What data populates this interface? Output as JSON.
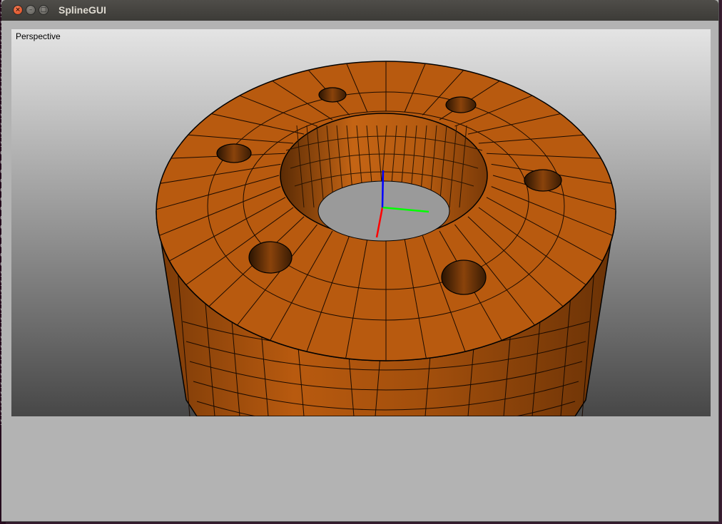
{
  "window": {
    "title": "SplineGUI",
    "buttons": {
      "close": "×",
      "minimize": "–",
      "maximize": "□"
    }
  },
  "background_terminal": {
    "lines": [
      "y",
      "y",
      "y",
      "y",
      "y",
      "y",
      "y",
      "y",
      "y",
      "y",
      "y",
      "y",
      "y",
      "y",
      "y",
      "y",
      "e",
      "e",
      "e",
      "e",
      "e",
      "e",
      "e",
      "e",
      "e",
      "e",
      "e",
      "e",
      "e",
      "y",
      "y",
      "y",
      "y",
      "y",
      "y",
      "y",
      "y",
      "y",
      "y",
      "y",
      "y",
      "y",
      "y",
      "y",
      "y",
      "y"
    ]
  },
  "viewport": {
    "label": "Perspective",
    "background_top": "#e4e4e4",
    "background_bottom": "#474747",
    "model_color": "#b85a0f",
    "axes": {
      "x_color": "#ff0000",
      "y_color": "#00ff00",
      "z_color": "#0000ff"
    }
  },
  "colors": {
    "window_bg": "#b3b3b3",
    "titlebar": "#3c3b37",
    "close_button": "#e05a2a"
  },
  "icons": [
    "close-icon",
    "minimize-icon",
    "maximize-icon"
  ]
}
